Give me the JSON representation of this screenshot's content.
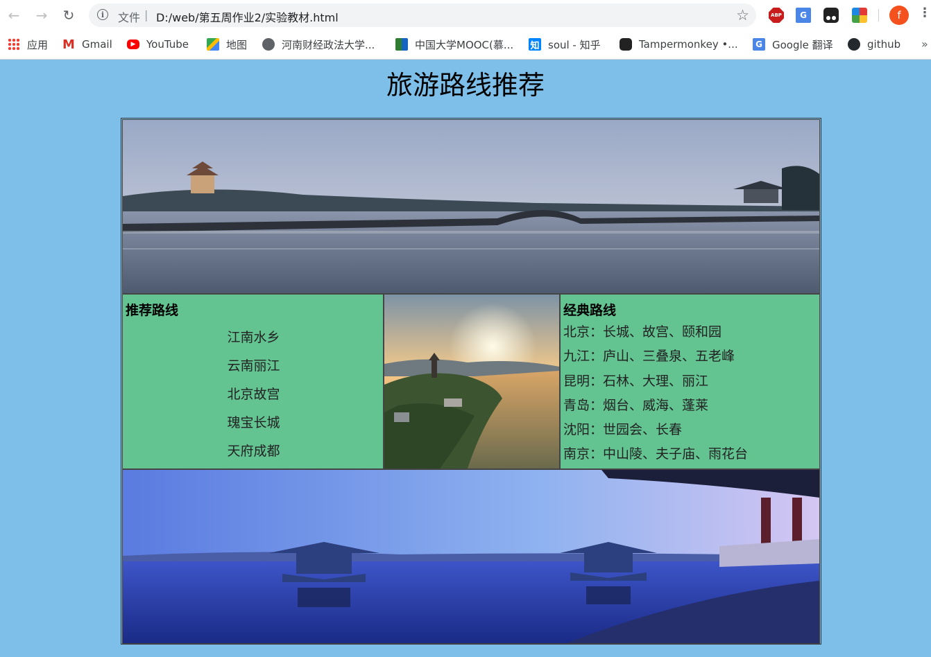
{
  "browser": {
    "scheme_label": "文件",
    "url": "D:/web/第五周作业2/实验教材.html",
    "bookmarks": [
      {
        "label": "应用",
        "icon": "apps-grid-icon"
      },
      {
        "label": "Gmail",
        "icon": "gmail-icon"
      },
      {
        "label": "YouTube",
        "icon": "youtube-icon"
      },
      {
        "label": "地图",
        "icon": "maps-icon"
      },
      {
        "label": "河南财经政法大学...",
        "icon": "globe-icon"
      },
      {
        "label": "中国大学MOOC(慕...",
        "icon": "mooc-icon"
      },
      {
        "label": "soul - 知乎",
        "icon": "zhihu-icon"
      },
      {
        "label": "Tampermonkey •...",
        "icon": "tampermonkey-icon"
      },
      {
        "label": "Google 翻译",
        "icon": "google-translate-icon"
      },
      {
        "label": "github",
        "icon": "github-icon"
      }
    ],
    "extensions": [
      "abp-icon",
      "translate-icon",
      "tampermonkey-icon",
      "color-picker-icon"
    ],
    "avatar_letter": "f",
    "translate_glyph": "G",
    "abp_glyph": "ABP",
    "zhihu_glyph": "知",
    "gmail_glyph": "M"
  },
  "page": {
    "title": "旅游路线推荐",
    "background_color": "#7dbfe9",
    "cell_color": "#63c391",
    "recommended": {
      "heading": "推荐路线",
      "items": [
        "江南水乡",
        "云南丽江",
        "北京故宫",
        "瑰宝长城",
        "天府成都"
      ]
    },
    "classic": {
      "heading": "经典路线",
      "items": [
        "北京：长城、故宫、颐和园",
        "九江：庐山、三叠泉、五老峰",
        "昆明：石林、大理、丽江",
        "青岛：烟台、威海、蓬莱",
        "沈阳：世园会、长春",
        "南京：中山陵、夫子庙、雨花台"
      ]
    }
  }
}
